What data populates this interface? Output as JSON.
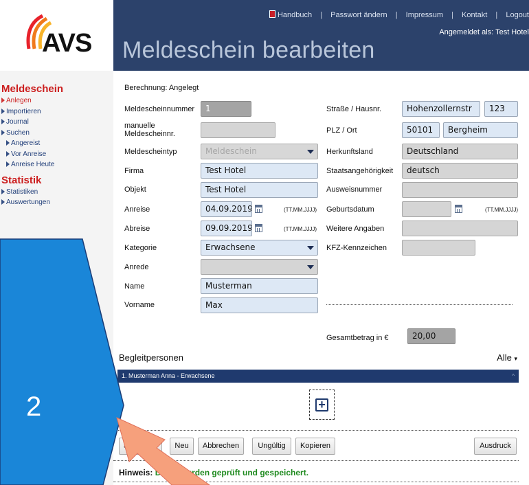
{
  "brand": {
    "logo_text": "AVS"
  },
  "topnav": {
    "handbuch": "Handbuch",
    "passwort": "Passwort ändern",
    "impressum": "Impressum",
    "kontakt": "Kontakt",
    "logout": "Logout",
    "logged_in": "Angemeldet als: Test Hotel"
  },
  "page_title": "Meldeschein bearbeiten",
  "sidebar": {
    "meldeschein_heading": "Meldeschein",
    "anlegen": "Anlegen",
    "importieren": "Importieren",
    "journal": "Journal",
    "suchen": "Suchen",
    "angereist": "Angereist",
    "vor_anreise": "Vor Anreise",
    "anreise_heute": "Anreise Heute",
    "statistik_heading": "Statistik",
    "statistiken": "Statistiken",
    "auswertungen": "Auswertungen"
  },
  "form": {
    "status": "Berechnung: Angelegt",
    "labels": {
      "nummer": "Meldescheinnummer",
      "manuell": "manuelle Meldescheinnr.",
      "typ": "Meldescheintyp",
      "firma": "Firma",
      "objekt": "Objekt",
      "anreise": "Anreise",
      "abreise": "Abreise",
      "kategorie": "Kategorie",
      "anrede": "Anrede",
      "name": "Name",
      "vorname": "Vorname",
      "strasse": "Straße / Hausnr.",
      "plz": "PLZ / Ort",
      "herkunft": "Herkunftsland",
      "staat": "Staatsangehörigkeit",
      "ausweis": "Ausweisnummer",
      "geburt": "Geburtsdatum",
      "weitere": "Weitere Angaben",
      "kfz": "KFZ-Kennzeichen",
      "gesamt": "Gesamtbetrag in €",
      "date_format": "(TT.MM.JJJJ)"
    },
    "values": {
      "nummer": "1",
      "manuell": "",
      "typ": "Meldeschein",
      "firma": "Test Hotel",
      "objekt": "Test Hotel",
      "anreise": "04.09.2019",
      "abreise": "09.09.2019",
      "kategorie": "Erwachsene",
      "anrede": "",
      "name": "Musterman",
      "vorname": "Max",
      "strasse": "Hohenzollernstr",
      "hausnr": "123",
      "plz": "50101",
      "ort": "Bergheim",
      "herkunft": "Deutschland",
      "staat": "deutsch",
      "ausweis": "",
      "geburt": "",
      "weitere": "",
      "kfz": "",
      "gesamt": "20,00"
    }
  },
  "begleit": {
    "heading": "Begleitpersonen",
    "filter": "Alle",
    "row": "1. Musterman Anna - Erwachsene"
  },
  "buttons": {
    "speichern": "Speichern",
    "neu": "Neu",
    "abbrechen": "Abbrechen",
    "ungueltig": "Ungültig",
    "kopieren": "Kopieren",
    "ausdruck": "Ausdruck"
  },
  "hint": {
    "prefix": "Hinweis:",
    "message": "Daten wurden geprüft und gespeichert."
  },
  "callout": {
    "number": "2",
    "fill_color": "#1a86d8",
    "arrow_color": "#f6a07c"
  }
}
